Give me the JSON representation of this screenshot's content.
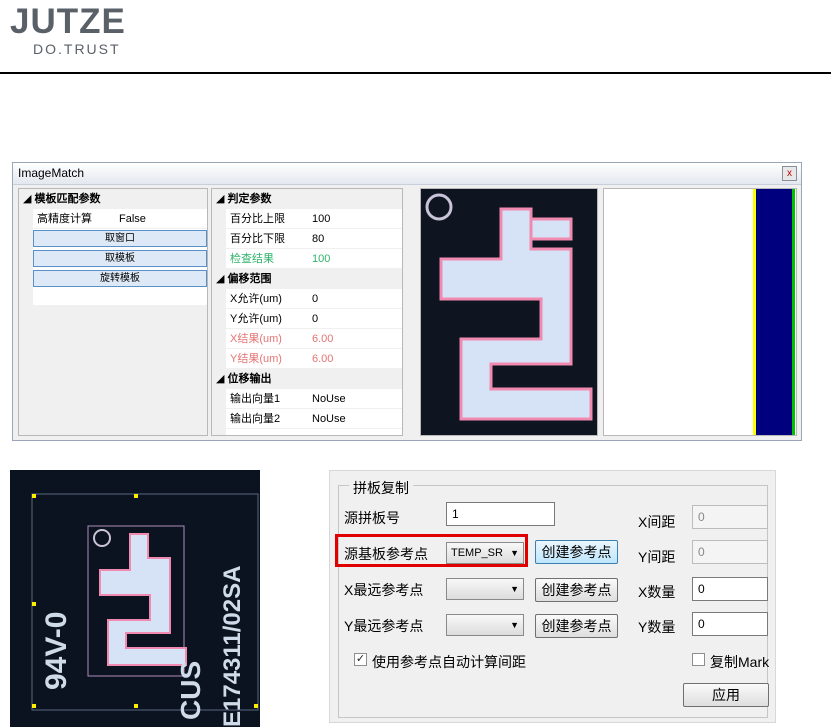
{
  "header": {
    "logo_main": "JUTZE",
    "logo_sub": "DO.TRUST"
  },
  "image_match": {
    "title": "ImageMatch",
    "close_label": "x",
    "left_grid": {
      "category": "模板匹配参数",
      "rows": [
        {
          "key": "高精度计算",
          "value": "False"
        }
      ],
      "buttons": [
        "取窗口",
        "取模板",
        "旋转模板"
      ]
    },
    "mid_grid": {
      "judge": {
        "category": "判定参数",
        "rows": [
          {
            "key": "百分比上限",
            "value": "100"
          },
          {
            "key": "百分比下限",
            "value": "80"
          },
          {
            "key": "检查结果",
            "value": "100"
          }
        ]
      },
      "offset": {
        "category": "偏移范围",
        "rows": [
          {
            "key": "X允许(um)",
            "value": "0"
          },
          {
            "key": "Y允许(um)",
            "value": "0"
          },
          {
            "key": "X结果(um)",
            "value": "6.00"
          },
          {
            "key": "Y结果(um)",
            "value": "6.00"
          }
        ]
      },
      "output": {
        "category": "位移输出",
        "rows": [
          {
            "key": "输出向量1",
            "value": "NoUse"
          },
          {
            "key": "输出向量2",
            "value": "NoUse"
          }
        ]
      }
    },
    "colors": {
      "result_ok": "#2fb36b",
      "result_offset": "#e57373",
      "bar_yellow": "#ffff00",
      "bar_blue": "#00007f"
    }
  },
  "board_image": {
    "text_vertical_1": "94V-0",
    "text_vertical_2": "E174311/02SA",
    "text_vertical_3": "CUS"
  },
  "panel_copy": {
    "group_title": "拼板复制",
    "source_board_label": "源拼板号",
    "source_board_value": "1",
    "source_ref_label": "源基板参考点",
    "source_ref_value": "TEMP_SR",
    "x_far_label": "X最远参考点",
    "x_far_value": "",
    "y_far_label": "Y最远参考点",
    "y_far_value": "",
    "create_ref_label": "创建参考点",
    "x_spacing_label": "X间距",
    "x_spacing_value": "0",
    "y_spacing_label": "Y间距",
    "y_spacing_value": "0",
    "x_count_label": "X数量",
    "x_count_value": "0",
    "y_count_label": "Y数量",
    "y_count_value": "0",
    "auto_spacing_label": "使用参考点自动计算间距",
    "auto_spacing_checked": true,
    "copy_mark_label": "复制Mark",
    "copy_mark_checked": false,
    "apply_label": "应用"
  }
}
